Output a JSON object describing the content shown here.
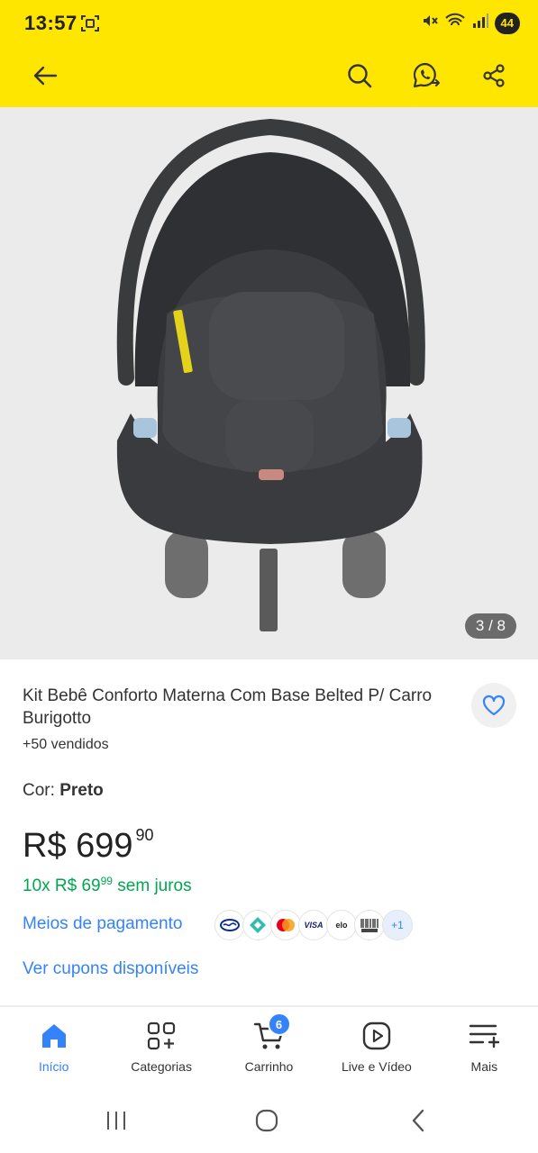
{
  "status_bar": {
    "time": "13:57",
    "battery": "44"
  },
  "header": {
    "icons": [
      "back-arrow-icon",
      "search-icon",
      "whatsapp-share-icon",
      "share-icon"
    ]
  },
  "gallery": {
    "counter": "3 / 8"
  },
  "product": {
    "title": "Kit Bebê Conforto Materna Com Base Belted P/ Carro Burigotto",
    "sold": "+50 vendidos",
    "color_label": "Cor:",
    "color_value": "Preto",
    "price_main": "R$ 699",
    "price_cents": "90",
    "installment_prefix": "10x R$ 69",
    "installment_cents": "99",
    "installment_suffix": "sem juros",
    "payment_link": "Meios de pagamento",
    "payment_methods": [
      "mercadopago",
      "pix",
      "mastercard",
      "VISA",
      "elo",
      "Boleto"
    ],
    "payment_more": "+1",
    "coupons_link": "Ver cupons disponíveis"
  },
  "tabbar": {
    "items": [
      {
        "label": "Início",
        "icon": "home-icon",
        "active": true
      },
      {
        "label": "Categorias",
        "icon": "categories-icon"
      },
      {
        "label": "Carrinho",
        "icon": "cart-icon",
        "badge": "6"
      },
      {
        "label": "Live e Vídeo",
        "icon": "play-icon"
      },
      {
        "label": "Mais",
        "icon": "menu-plus-icon"
      }
    ]
  },
  "system_nav": {
    "icons": [
      "recents-icon",
      "home-circle-icon",
      "back-chevron-icon"
    ]
  },
  "colors": {
    "brand_yellow": "#FFE600",
    "link_blue": "#3483fa",
    "green": "#00a650"
  }
}
